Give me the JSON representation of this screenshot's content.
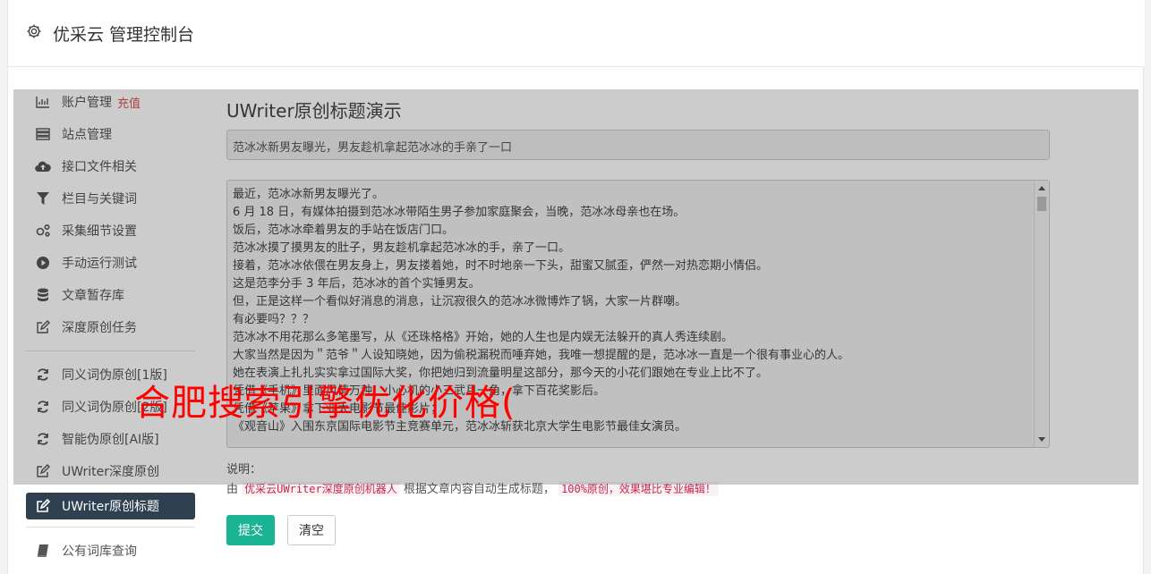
{
  "header": {
    "title": "优采云 管理控制台",
    "icon": "gear-icon"
  },
  "sidebar": {
    "items": [
      {
        "label": "账户管理",
        "badge": "充值",
        "icon": "bar-chart-icon"
      },
      {
        "label": "站点管理",
        "icon": "server-icon"
      },
      {
        "label": "接口文件相关",
        "icon": "cloud-upload-icon"
      },
      {
        "label": "栏目与关键词",
        "icon": "filter-icon"
      },
      {
        "label": "采集细节设置",
        "icon": "gears-icon"
      },
      {
        "label": "手动运行测试",
        "icon": "play-circle-icon"
      },
      {
        "label": "文章暂存库",
        "icon": "database-icon"
      },
      {
        "label": "深度原创任务",
        "icon": "edit-icon"
      },
      {
        "label": "同义词伪原创[1版]",
        "icon": "refresh-icon"
      },
      {
        "label": "同义词伪原创[2版]",
        "icon": "refresh-icon"
      },
      {
        "label": "智能伪原创[AI版]",
        "icon": "refresh-icon"
      },
      {
        "label": "UWriter深度原创",
        "icon": "edit-icon"
      },
      {
        "label": "UWriter原创标题",
        "icon": "edit-icon",
        "active": true
      },
      {
        "label": "公有词库查询",
        "icon": "book-icon"
      }
    ]
  },
  "main": {
    "page_title": "UWriter原创标题演示",
    "title_value": "范冰冰新男友曝光，男友趁机拿起范冰冰的手亲了一口",
    "content_lines": [
      "最近，范冰冰新男友曝光了。",
      "6 月 18 日，有媒体拍摄到范冰冰带陌生男子参加家庭聚会，当晚，范冰冰母亲也在场。",
      "饭后，范冰冰牵着男友的手站在饭店门口。",
      "范冰冰摸了摸男友的肚子，男友趁机拿起范冰冰的手，亲了一口。",
      "接着，范冰冰依偎在男友身上，男友搂着她，时不时地亲一下头，甜蜜又腻歪，俨然一对热恋期小情侣。",
      "这是范李分手 3 年后，范冰冰的首个实锤男友。",
      "但，正是这样一个看似好消息的消息，让沉寂很久的范冰冰微博炸了锅，大家一片群嘲。",
      "有必要吗？？？",
      "范冰冰不用花那么多笔墨写，从《还珠格格》开始，她的人生也是内娱无法躲开的真人秀连续剧。",
      "大家当然是因为＂范爷＂人设知晓她，因为偷税漏税而唾弃她，我唯一想提醒的是，范冰冰一直是一个很有事业心的人。",
      "她在表演上扎扎实实拿过国际大奖，你把她归到流量明星这部分，那今天的小花们跟她在专业上比不了。",
      "凭借《手机》里面风情万种、小心机的小三武月一角，拿下百花奖影后。",
      "凭借《苹果》拿下亚太电影节最佳影片；",
      "《观音山》入围东京国际电影节主竞赛单元，范冰冰斩获北京大学生电影节最佳女演员。"
    ],
    "desc_label": "说明：",
    "desc_prefix": "由",
    "desc_code1": "优采云UWriter深度原创机器人",
    "desc_mid": "根据文章内容自动生成标题，",
    "desc_code2": "100%原创，效果堪比专业编辑！",
    "submit_label": "提交",
    "clear_label": "清空"
  },
  "watermark": "合肥搜索引擎优化价格(",
  "colors": {
    "active_nav": "#2f4050",
    "submit": "#1ab394",
    "badge": "#d9534f",
    "watermark": "#ff0000"
  }
}
